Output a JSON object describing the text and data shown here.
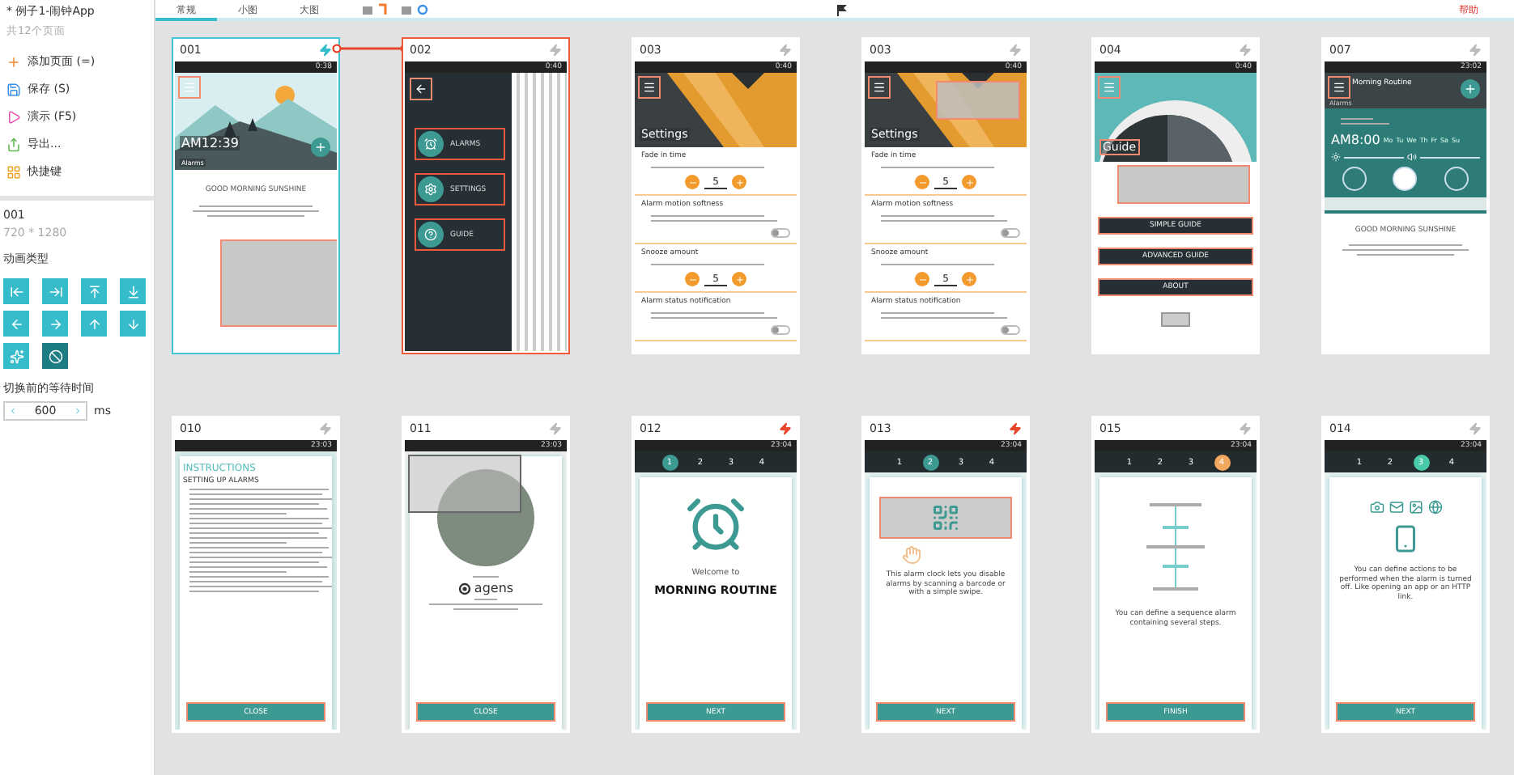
{
  "project": {
    "title": "* 例子1-闹钟App",
    "page_count": "共12个页面"
  },
  "actions": [
    {
      "kind": "add",
      "label": "添加页面 (=)"
    },
    {
      "kind": "save",
      "label": "保存 (S)"
    },
    {
      "kind": "play",
      "label": "演示 (F5)"
    },
    {
      "kind": "export",
      "label": "导出..."
    },
    {
      "kind": "keys",
      "label": "快捷键"
    }
  ],
  "page_props": {
    "name": "001",
    "size": "720 * 1280",
    "anim_label": "动画类型",
    "wait_label": "切换前的等待时间",
    "wait_value": "600",
    "wait_unit": "ms",
    "anim_buttons": [
      {
        "kind": "push-left",
        "selected": false
      },
      {
        "kind": "push-right",
        "selected": false
      },
      {
        "kind": "push-up",
        "selected": false
      },
      {
        "kind": "push-down",
        "selected": false
      },
      {
        "kind": "slide-left",
        "selected": false
      },
      {
        "kind": "slide-right",
        "selected": false
      },
      {
        "kind": "slide-up",
        "selected": false
      },
      {
        "kind": "slide-down",
        "selected": false
      },
      {
        "kind": "fade",
        "selected": false
      },
      {
        "kind": "none",
        "selected": true
      }
    ]
  },
  "view_tabs": [
    {
      "label": "常规",
      "selected": true
    },
    {
      "label": "小图",
      "selected": false
    },
    {
      "label": "大图",
      "selected": false
    }
  ],
  "help": "帮助",
  "screens": [
    {
      "number": "001",
      "kind": "home",
      "selected": true,
      "link_target": false,
      "color": "#37bccb",
      "link_out": true,
      "time": "0:38",
      "clock": "AM12:39",
      "label": "Alarms",
      "heading": "GOOD MORNING SUNSHINE",
      "hotspot": true
    },
    {
      "number": "002",
      "kind": "drawer",
      "selected": false,
      "link_target": true,
      "color": "#bbbbbb",
      "link_out": false,
      "time": "0:40",
      "items": [
        {
          "kind": "alarm",
          "label": "ALARMS"
        },
        {
          "kind": "settings",
          "label": "SETTINGS"
        },
        {
          "kind": "guide",
          "label": "GUIDE"
        }
      ]
    },
    {
      "number": "003",
      "kind": "settings",
      "selected": false,
      "link_target": false,
      "color": "#bbbbbb",
      "link_out": false,
      "time": "0:40",
      "title": "Settings",
      "hotspot": false,
      "rows": [
        {
          "kind": "stepper",
          "label": "Fade in time",
          "value": "5"
        },
        {
          "kind": "toggle",
          "label": "Alarm motion softness",
          "on": false
        },
        {
          "kind": "stepper",
          "label": "Snooze amount",
          "value": "5"
        },
        {
          "kind": "toggle",
          "label": "Alarm status notification",
          "on": false
        }
      ]
    },
    {
      "number": "003",
      "kind": "settings",
      "selected": false,
      "link_target": false,
      "color": "#bbbbbb",
      "link_out": false,
      "time": "0:40",
      "title": "Settings",
      "hotspot": true,
      "rows": [
        {
          "kind": "stepper",
          "label": "Fade in time",
          "value": "5"
        },
        {
          "kind": "toggle",
          "label": "Alarm motion softness",
          "on": false
        },
        {
          "kind": "stepper",
          "label": "Snooze amount",
          "value": "5"
        },
        {
          "kind": "toggle",
          "label": "Alarm status notification",
          "on": false
        }
      ]
    },
    {
      "number": "004",
      "kind": "guide",
      "selected": false,
      "link_target": false,
      "color": "#bbbbbb",
      "link_out": false,
      "time": "0:40",
      "title": "Guide",
      "hotspot": true,
      "buttons": [
        "SIMPLE GUIDE",
        "ADVANCED GUIDE",
        "ABOUT"
      ]
    },
    {
      "number": "007",
      "kind": "routine",
      "selected": false,
      "link_target": false,
      "color": "#bbbbbb",
      "link_out": false,
      "time": "23:02",
      "title": "Morning Routine",
      "label": "Alarms",
      "clock": "AM8:00",
      "days": [
        "Mo",
        "Tu",
        "We",
        "Th",
        "Fr",
        "Sa",
        "Su"
      ],
      "heading": "GOOD MORNING SUNSHINE"
    },
    {
      "number": "010",
      "kind": "instructions",
      "selected": false,
      "link_target": false,
      "color": "#bbbbbb",
      "link_out": false,
      "time": "23:03",
      "title": "INSTRUCTIONS",
      "subtitle": "SETTING UP ALARMS",
      "button": "CLOSE"
    },
    {
      "number": "011",
      "kind": "about",
      "selected": false,
      "link_target": false,
      "color": "#bbbbbb",
      "link_out": false,
      "time": "23:03",
      "hotspot": true,
      "logo": "agens",
      "button": "CLOSE"
    },
    {
      "number": "012",
      "kind": "welcome",
      "selected": false,
      "link_target": false,
      "color": "#e8472b",
      "link_out": false,
      "time": "23:04",
      "steps": [
        {
          "label": "1",
          "selected": true,
          "color": "#3d9a93"
        },
        {
          "label": "2",
          "selected": false
        },
        {
          "label": "3",
          "selected": false
        },
        {
          "label": "4",
          "selected": false
        }
      ],
      "pre": "Welcome to",
      "text": "MORNING ROUTINE",
      "button": "NEXT"
    },
    {
      "number": "013",
      "kind": "barcode",
      "selected": false,
      "link_target": false,
      "color": "#e8472b",
      "link_out": false,
      "time": "23:04",
      "steps": [
        {
          "label": "1",
          "selected": false
        },
        {
          "label": "2",
          "selected": true,
          "color": "#3d9a93"
        },
        {
          "label": "3",
          "selected": false
        },
        {
          "label": "4",
          "selected": false
        }
      ],
      "text": "This alarm clock lets you disable alarms by scanning a barcode or with a simple swipe.",
      "button": "NEXT"
    },
    {
      "number": "015",
      "kind": "sequence",
      "selected": false,
      "link_target": false,
      "color": "#bbbbbb",
      "link_out": false,
      "time": "23:04",
      "steps": [
        {
          "label": "1",
          "selected": false
        },
        {
          "label": "2",
          "selected": false
        },
        {
          "label": "3",
          "selected": false
        },
        {
          "label": "4",
          "selected": true,
          "color": "#f3a860"
        }
      ],
      "text": "You can define a sequence alarm containing several steps.",
      "button": "FINISH"
    },
    {
      "number": "014",
      "kind": "actions",
      "selected": false,
      "link_target": false,
      "color": "#bbbbbb",
      "link_out": false,
      "time": "23:04",
      "steps": [
        {
          "label": "1",
          "selected": false
        },
        {
          "label": "2",
          "selected": false
        },
        {
          "label": "3",
          "selected": true,
          "color": "#48c9a9"
        },
        {
          "label": "4",
          "selected": false
        }
      ],
      "text": "You can define actions to be performed when the alarm is turned off. Like opening an app or an HTTP link.",
      "button": "NEXT"
    }
  ]
}
